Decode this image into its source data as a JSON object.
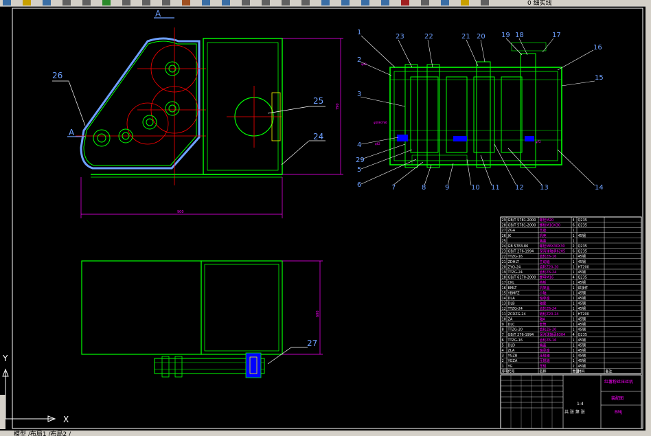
{
  "toolbar": {
    "icons": [
      "new-icon",
      "open-icon",
      "save-icon",
      "plot-icon",
      "preview-icon",
      "publish-icon",
      "cut-icon",
      "copy-icon",
      "paste-icon",
      "match-icon",
      "undo-icon",
      "redo-icon",
      "pan-icon",
      "zoom-realtime-icon",
      "zoom-window-icon",
      "zoom-previous-icon",
      "properties-icon",
      "design-center-icon",
      "tool-palette-icon",
      "sheet-set-icon",
      "markup-icon",
      "calc-icon",
      "help-icon",
      "layer-icon",
      "layer-state-icon"
    ],
    "layer_name": "0 细实线"
  },
  "colors": {
    "background": "#000000",
    "outline": "#00ff00",
    "hidden": "#ff0000",
    "dimension": "#ff00ff",
    "leader": "#6ea0ff",
    "text": "#ffffff",
    "table_header": "#ff00ff",
    "cyan": "#00ffff",
    "yellow": "#ffff00",
    "blue": "#0000ff"
  },
  "views": {
    "section_mark_top": "A",
    "section_mark_left": "A",
    "front_labels": [
      "26",
      "25",
      "24"
    ],
    "plan_labels": [
      "27"
    ],
    "section_top_labels": [
      "1",
      "23",
      "22",
      "21",
      "20",
      "19",
      "18",
      "17",
      "16"
    ],
    "section_left_labels": [
      "2",
      "3",
      "4",
      "29",
      "5",
      "6"
    ],
    "section_bottom_labels": [
      "7",
      "8",
      "9",
      "10",
      "11",
      "12",
      "13",
      "14"
    ],
    "section_right_labels": [
      "15"
    ]
  },
  "bom": {
    "rows": [
      {
        "no": "29",
        "code": "GB/T 5781-2000",
        "name": "螺栓M20",
        "qty": "4",
        "mat": "Q235"
      },
      {
        "no": "28",
        "code": "GB/T 5781-2000",
        "name": "螺栓M10X30",
        "qty": "6",
        "mat": "Q235"
      },
      {
        "no": "27",
        "code": "ZGA",
        "name": "支座",
        "qty": "1",
        "mat": ""
      },
      {
        "no": "26",
        "code": "JK",
        "name": "机壳",
        "qty": "1",
        "mat": "45钢"
      },
      {
        "no": "25",
        "code": "",
        "name": "端盖",
        "qty": "1",
        "mat": ""
      },
      {
        "no": "24",
        "code": "GB 5783-86",
        "name": "螺栓M8X30X30",
        "qty": "2",
        "mat": "Q235"
      },
      {
        "no": "23",
        "code": "GB/T 276-1994",
        "name": "深沟球轴承6205",
        "qty": "6",
        "mat": "Q235"
      },
      {
        "no": "22",
        "code": "TTZG-16",
        "name": "齿轮Z6-16",
        "qty": "1",
        "mat": "45钢"
      },
      {
        "no": "21",
        "code": "ZDHLT",
        "name": "主动轴",
        "qty": "1",
        "mat": "45钢"
      },
      {
        "no": "20",
        "code": "ZYQ-24",
        "name": "齿轮Z20-20",
        "qty": "1",
        "mat": "HT200"
      },
      {
        "no": "19",
        "code": "TTZG-24",
        "name": "齿轮Z6-24",
        "qty": "1",
        "mat": "45钢"
      },
      {
        "no": "18",
        "code": "GB/T 6170-2000",
        "name": "螺母M16",
        "qty": "4",
        "mat": "Q235"
      },
      {
        "no": "17",
        "code": "CKL",
        "name": "挡板",
        "qty": "1",
        "mat": "45钢"
      },
      {
        "no": "16",
        "code": "BMLT",
        "name": "机架盖",
        "qty": "1",
        "mat": "焊接件"
      },
      {
        "no": "15",
        "code": "YBMFZ",
        "name": "小轴",
        "qty": "1",
        "mat": "45钢"
      },
      {
        "no": "14",
        "code": "DLA",
        "name": "轴承座",
        "qty": "1",
        "mat": "45钢"
      },
      {
        "no": "13",
        "code": "DLB",
        "name": "轴套",
        "qty": "1",
        "mat": "45钢"
      },
      {
        "no": "12",
        "code": "TTZG-24",
        "name": "齿轮Z6-24",
        "qty": "1",
        "mat": "45钢"
      },
      {
        "no": "11",
        "code": "ZCDZG-24",
        "name": "链轮Z20-24",
        "qty": "1",
        "mat": "HT200"
      },
      {
        "no": "10",
        "code": "ZA",
        "name": "轴A",
        "qty": "1",
        "mat": "45钢"
      },
      {
        "no": "9",
        "code": "DLC",
        "name": "套筒",
        "qty": "1",
        "mat": "45钢"
      },
      {
        "no": "8",
        "code": "TTZG-20",
        "name": "齿轮Z6-20",
        "qty": "1",
        "mat": "45钢"
      },
      {
        "no": "7",
        "code": "GB/T 276-1994",
        "name": "深沟球轴承6304",
        "qty": "4",
        "mat": "Q235"
      },
      {
        "no": "6",
        "code": "TTZG-16",
        "name": "齿轮Z6-16",
        "qty": "1",
        "mat": "45钢"
      },
      {
        "no": "5",
        "code": "DLD",
        "name": "端盖",
        "qty": "1",
        "mat": "45钢"
      },
      {
        "no": "4",
        "code": "ZLA",
        "name": "轴承座",
        "qty": "1",
        "mat": "45钢"
      },
      {
        "no": "3",
        "code": "YGZB",
        "name": "压辊轴",
        "qty": "1",
        "mat": "45钢"
      },
      {
        "no": "2",
        "code": "YGZA",
        "name": "压辊轴",
        "qty": "1",
        "mat": "45钢"
      },
      {
        "no": "1",
        "code": "YG",
        "name": "压辊",
        "qty": "2",
        "mat": "45钢"
      }
    ],
    "header": [
      "序号",
      "代号",
      "名称",
      "数量",
      "材料",
      "备注"
    ],
    "title_block": {
      "product": "红薯粉丝压丝机",
      "drawing": "装配图",
      "code": "BMJ",
      "scale": "1:4",
      "sheets": "共 张 第 张"
    }
  },
  "status": {
    "text": "模型 /布局1 /布局2 /"
  },
  "ucs": {
    "x": "X",
    "y": "Y"
  }
}
